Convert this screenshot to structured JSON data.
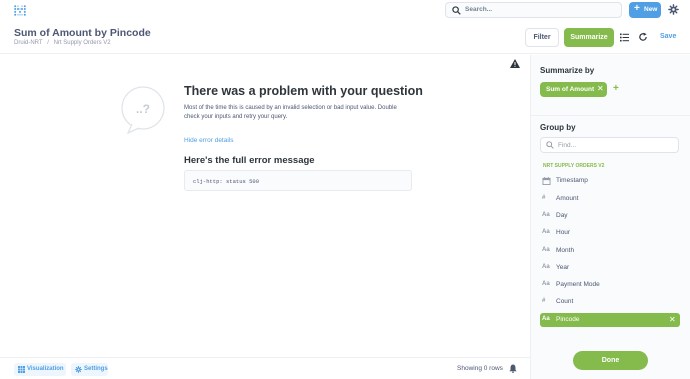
{
  "nav": {
    "search_placeholder": "Search...",
    "new_label": "New"
  },
  "question": {
    "title": "Sum of Amount by Pincode",
    "breadcrumbs": [
      "Druid-NRT",
      "/",
      "Nrt Supply Orders V2"
    ],
    "filter_label": "Filter",
    "summarize_label": "Summarize",
    "save_label": "Save"
  },
  "error": {
    "title": "There was a problem with your question",
    "description": "Most of the time this is caused by an invalid selection or bad input value. Double check your inputs and retry your query.",
    "hide_details": "Hide error details",
    "full_message_title": "Here's the full error message",
    "message": "clj-http: status 500"
  },
  "footer": {
    "visualization_label": "Visualization",
    "settings_label": "Settings",
    "row_count": "Showing 0 rows"
  },
  "sidebar": {
    "summarize_by_title": "Summarize by",
    "metric": "Sum of Amount",
    "group_by_title": "Group by",
    "find_placeholder": "Find...",
    "section": "NRT SUPPLY ORDERS V2",
    "columns": [
      {
        "label": "Timestamp",
        "type": "calendar"
      },
      {
        "label": "Amount",
        "type": "#"
      },
      {
        "label": "Day",
        "type": "Aa"
      },
      {
        "label": "Hour",
        "type": "Aa"
      },
      {
        "label": "Month",
        "type": "Aa"
      },
      {
        "label": "Year",
        "type": "Aa"
      },
      {
        "label": "Payment Mode",
        "type": "Aa"
      },
      {
        "label": "Count",
        "type": "#"
      },
      {
        "label": "Pincode",
        "type": "Aa",
        "selected": true
      }
    ],
    "done_label": "Done"
  },
  "colors": {
    "brand": "#509ee3",
    "summarize": "#84bb4c",
    "text": "#4c5773"
  }
}
